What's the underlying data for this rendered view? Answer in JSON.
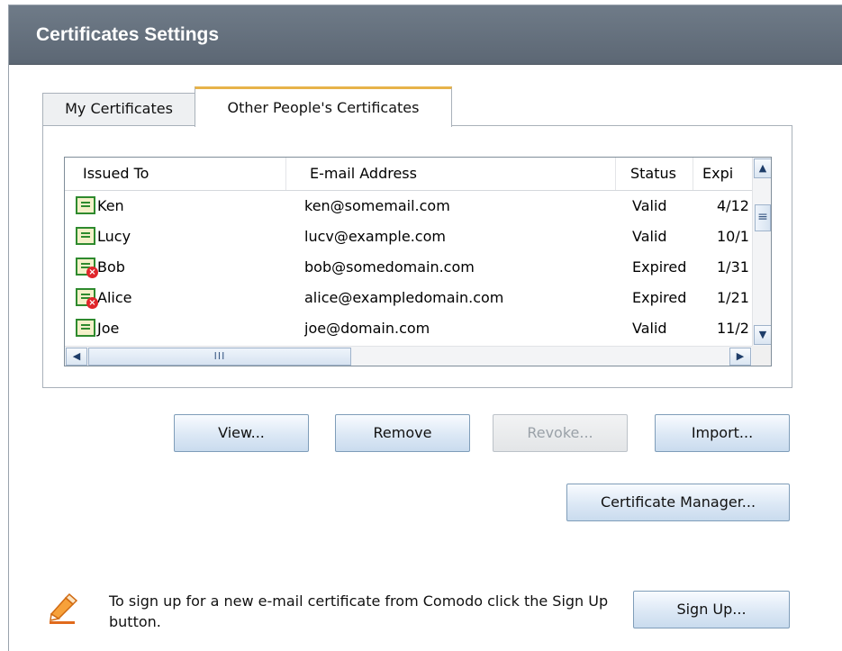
{
  "window": {
    "title": "Certificates Settings"
  },
  "tabs": [
    {
      "label": "My Certificates",
      "active": false
    },
    {
      "label": "Other People's Certificates",
      "active": true
    }
  ],
  "table": {
    "columns": [
      "Issued To",
      "E-mail Address",
      "Status",
      "Expi"
    ],
    "rows": [
      {
        "name": "Ken",
        "email": "ken@somemail.com",
        "status": "Valid",
        "expires": "4/12",
        "icon": "certificate-valid-icon"
      },
      {
        "name": "Lucy",
        "email": "lucv@example.com",
        "status": "Valid",
        "expires": "10/1",
        "icon": "certificate-valid-icon"
      },
      {
        "name": "Bob",
        "email": "bob@somedomain.com",
        "status": "Expired",
        "expires": "1/31",
        "icon": "certificate-expired-icon"
      },
      {
        "name": "Alice",
        "email": "alice@exampledomain.com",
        "status": "Expired",
        "expires": "1/21",
        "icon": "certificate-expired-icon"
      },
      {
        "name": "Joe",
        "email": "joe@domain.com",
        "status": "Valid",
        "expires": "11/2",
        "icon": "certificate-valid-icon"
      }
    ]
  },
  "buttons": {
    "view": "View...",
    "remove": "Remove",
    "revoke": "Revoke...",
    "import": "Import...",
    "certificate_manager": "Certificate Manager...",
    "sign_up": "Sign Up..."
  },
  "signup": {
    "text": "To sign up for a new e-mail certificate from Comodo click the Sign Up button.",
    "icon": "pencil-eraser-icon"
  },
  "colors": {
    "titlebar": "#5f6b78",
    "active_tab_accent": "#e7b34a",
    "button_border": "#7f9db9",
    "valid_cert_green": "#2e8a2e",
    "expired_badge_red": "#e0262b"
  }
}
